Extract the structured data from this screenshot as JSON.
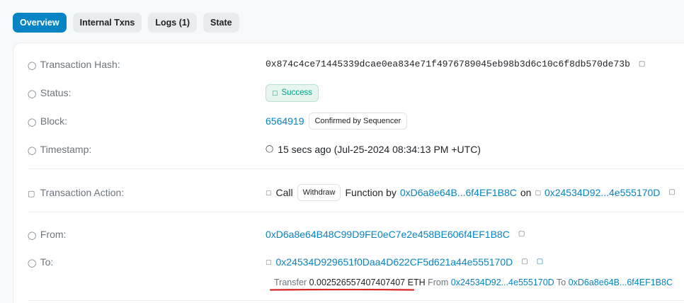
{
  "tabs": [
    {
      "label": "Overview"
    },
    {
      "label": "Internal Txns"
    },
    {
      "label": "Logs (1)"
    },
    {
      "label": "State"
    }
  ],
  "tx": {
    "hash_label": "Transaction Hash:",
    "hash_value": "0x874c4ce71445339dcae0ea834e71f4976789045eb98b3d6c10c6f8db570de73b",
    "status_label": "Status:",
    "status_value": "Success",
    "block_label": "Block:",
    "block_value": "6564919",
    "block_badge": "Confirmed by Sequencer",
    "timestamp_label": "Timestamp:",
    "timestamp_value": "15 secs ago (Jul-25-2024 08:34:13 PM +UTC)",
    "action_label": "Transaction Action:",
    "action_call": "Call",
    "action_method": "Withdraw",
    "action_function_by": "Function by",
    "action_from": "0xD6a8e64B...6f4EF1B8C",
    "action_on": "on",
    "action_to": "0x24534D92...4e555170D",
    "from_label": "From:",
    "from_value": "0xD6a8e64B48C99D9FE0eC7e2e458BE606f4EF1B8C",
    "to_label": "To:",
    "to_value": "0x24534D929651f0Daa4D622CF5d621a44e555170D",
    "transfer_word": "Transfer",
    "transfer_amount": "0.002526557407407407",
    "transfer_unit": "ETH",
    "transfer_from_word": "From",
    "transfer_from": "0x24534D92...4e555170D",
    "transfer_to_word": "To",
    "transfer_to": "0xD6a8e64B...6f4EF1B8C"
  },
  "colors": {
    "accent": "#0784c3",
    "success": "#00a186",
    "annotation": "#d62828"
  },
  "icons": {
    "label_icon": "info-icon",
    "copy": "copy-icon",
    "clock": "clock-icon",
    "contract": "contract-icon"
  }
}
